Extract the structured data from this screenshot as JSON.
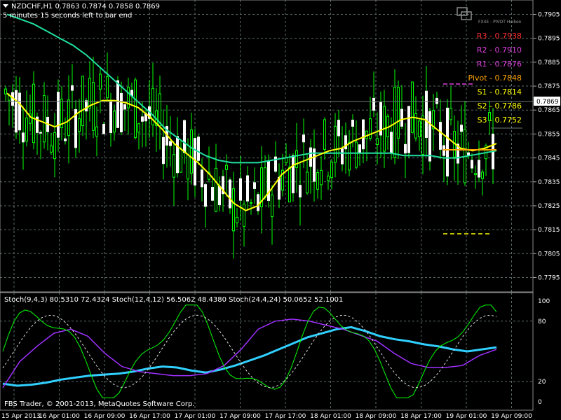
{
  "header": {
    "symbol_line": "NZDCHF,H1  0.7863 0.7874 0.7858 0.7869",
    "timer": "5 minutes 15 seconds left to bar end"
  },
  "logo": {
    "text": "FX4E - PIVOT Heiken"
  },
  "current_price": "0.7869",
  "pivots": [
    {
      "label": "R3 - 0.7938",
      "color": "#ff3030"
    },
    {
      "label": "R2 - 0.7910",
      "color": "#e040e0"
    },
    {
      "label": "R1 - 0.7876",
      "color": "#e040e0"
    },
    {
      "label": "Pivot - 0.7848",
      "color": "#ffa500"
    },
    {
      "label": "S1 - 0.7814",
      "color": "#ffff00"
    },
    {
      "label": "S2 - 0.7786",
      "color": "#ffff00"
    },
    {
      "label": "S3 - 0.7752",
      "color": "#ffff00"
    }
  ],
  "stoch_label": "Stoch(9,4,3) 80.5310 72.4324  Stoch(12,4,12) 56.5062 48.4380  Stoch(24,4,24) 50.0652 52.1001",
  "footer": "FBS Trader, © 2001-2013, MetaQuotes Software Corp.",
  "colors": {
    "candle": "#00ff00",
    "ma_yellow": "#ffff00",
    "ma_teal": "#20e0a0",
    "stoch_cyan": "#30d0ff",
    "stoch_purple": "#a030ff",
    "grid": "#5a6a6a"
  },
  "chart_data": {
    "type": "line",
    "price_axis": [
      "0.7905",
      "0.7895",
      "0.7885",
      "0.7875",
      "0.7865",
      "0.7855",
      "0.7845",
      "0.7835",
      "0.7825",
      "0.7815",
      "0.7805",
      "0.7795"
    ],
    "price_range": [
      0.7789,
      0.7911
    ],
    "time_axis": [
      "15 Apr 2013",
      "16 Apr 01:00",
      "16 Apr 09:00",
      "16 Apr 17:00",
      "17 Apr 01:00",
      "17 Apr 09:00",
      "17 Apr 17:00",
      "18 Apr 01:00",
      "18 Apr 09:00",
      "18 Apr 17:00",
      "19 Apr 01:00",
      "19 Apr 09:00"
    ],
    "stoch_axis": [
      "100",
      "80",
      "20",
      "0"
    ],
    "stoch_range": [
      0,
      100
    ],
    "series": [
      {
        "values": [
          0.7872,
          0.7868,
          0.7862,
          0.786,
          0.7858,
          0.786,
          0.7864,
          0.7867,
          0.7869,
          0.7869,
          0.7868,
          0.7866,
          0.7862,
          0.7857,
          0.7851,
          0.7847,
          0.7843,
          0.7838,
          0.7832,
          0.7826,
          0.7823,
          0.7825,
          0.7831,
          0.7838,
          0.7842,
          0.7844,
          0.7846,
          0.7848,
          0.7849,
          0.7852,
          0.7854,
          0.7856,
          0.7858,
          0.7861,
          0.7862,
          0.7861,
          0.7857,
          0.7853,
          0.7849,
          0.7848,
          0.7849,
          0.7851
        ]
      },
      {
        "values": [
          0.7905,
          0.7903,
          0.7901,
          0.7898,
          0.7895,
          0.7892,
          0.7888,
          0.7883,
          0.7878,
          0.7873,
          0.7868,
          0.7863,
          0.7857,
          0.7853,
          0.7849,
          0.7846,
          0.7844,
          0.7843,
          0.7843,
          0.7843,
          0.7844,
          0.7845,
          0.7846,
          0.7847,
          0.7847,
          0.7847,
          0.7847,
          0.7847,
          0.7847,
          0.7847,
          0.7846,
          0.7846,
          0.7846,
          0.7845,
          0.7845,
          0.7846,
          0.7847,
          0.7848
        ]
      }
    ],
    "stoch_series": [
      {
        "values": [
          18,
          16,
          17,
          19,
          22,
          24,
          26,
          27,
          28,
          30,
          33,
          35,
          34,
          31,
          29,
          32,
          36,
          41,
          46,
          52,
          58,
          64,
          68,
          72,
          74,
          70,
          65,
          62,
          60,
          57,
          55,
          52,
          50,
          52,
          54
        ]
      },
      {
        "values": [
          14,
          40,
          55,
          68,
          72,
          65,
          48,
          35,
          30,
          28,
          26,
          26,
          28,
          36,
          52,
          72,
          80,
          82,
          80,
          76,
          72,
          66,
          60,
          48,
          38,
          34,
          34,
          36,
          46,
          52
        ]
      }
    ]
  }
}
